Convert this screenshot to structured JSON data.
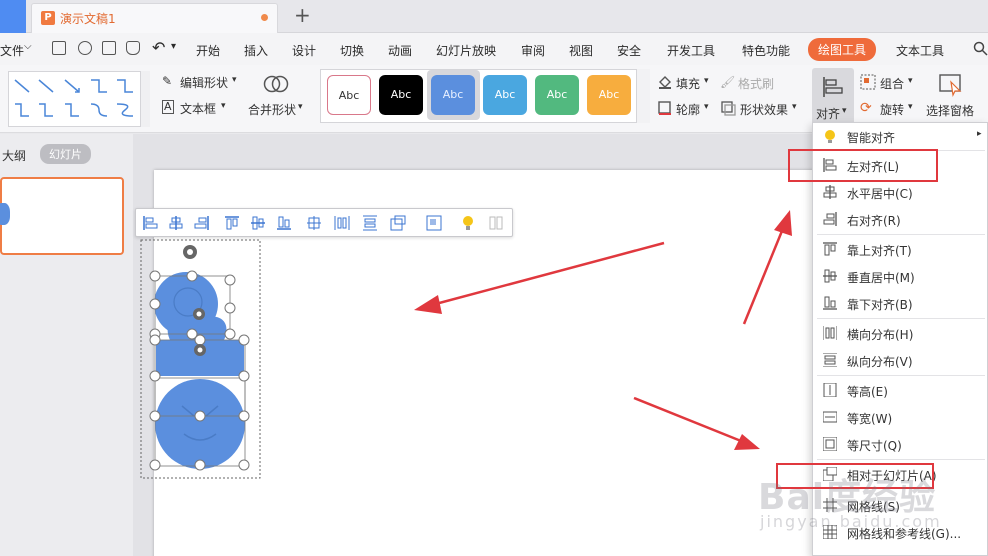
{
  "titlebar": {
    "doc_title": "演示文稿1",
    "new_tab": "+"
  },
  "menubar": {
    "file": "文件",
    "items": [
      "开始",
      "插入",
      "设计",
      "切换",
      "动画",
      "幻灯片放映",
      "审阅",
      "视图",
      "安全",
      "开发工具",
      "特色功能",
      "绘图工具",
      "文本工具"
    ],
    "active_index": 11
  },
  "ribbon": {
    "edit_shape": "编辑形状",
    "text_box": "文本框",
    "merge_shape": "合并形状",
    "style_sample": "Abc",
    "fill": "填充",
    "format_brush": "格式刷",
    "outline": "轮廓",
    "shape_effect": "形状效果",
    "align": "对齐",
    "group": "组合",
    "rotate": "旋转",
    "selection_pane": "选择窗格"
  },
  "style_colors": [
    "#ffffff",
    "#000000",
    "#5b8fde",
    "#4aa7e0",
    "#52b97f",
    "#f7ad3e"
  ],
  "leftpane": {
    "outline": "大纲",
    "slides": "幻灯片"
  },
  "align_menu": {
    "smart_align": "智能对齐",
    "left": "左对齐(L)",
    "hcenter": "水平居中(C)",
    "right": "右对齐(R)",
    "top": "靠上对齐(T)",
    "vcenter": "垂直居中(M)",
    "bottom": "靠下对齐(B)",
    "hdist": "横向分布(H)",
    "vdist": "纵向分布(V)",
    "same_height": "等高(E)",
    "same_width": "等宽(W)",
    "same_size": "等尺寸(Q)",
    "relative_slide": "相对于幻灯片(A)",
    "gridlines": "网格线(S)",
    "grid_guides": "网格线和参考线(G)..."
  },
  "colors": {
    "accent": "#ef6b3b",
    "highlight": "#e0383e",
    "shape_blue": "#5b8fde"
  },
  "watermark": {
    "brand": "Bai度经验",
    "url": "jingyan.baidu.com"
  }
}
